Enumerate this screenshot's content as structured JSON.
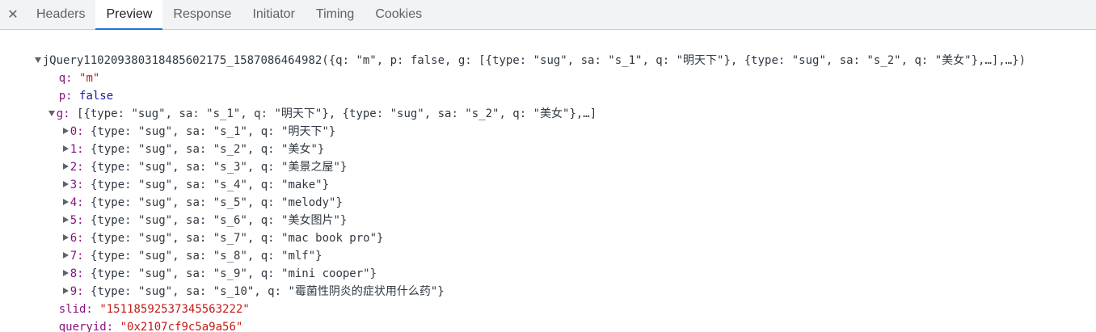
{
  "tabs": {
    "close": "✕",
    "items": [
      "Headers",
      "Preview",
      "Response",
      "Initiator",
      "Timing",
      "Cookies"
    ],
    "active": "Preview"
  },
  "preview": {
    "root_summary": "jQuery110209380318485602175_1587086464982({q: \"m\", p: false, g: [{type: \"sug\", sa: \"s_1\", q: \"明天下\"}, {type: \"sug\", sa: \"s_2\", q: \"美女\"},…],…})",
    "q": {
      "key": "q:",
      "value": "\"m\""
    },
    "p": {
      "key": "p:",
      "value": "false"
    },
    "g": {
      "key": "g:",
      "summary": "[{type: \"sug\", sa: \"s_1\", q: \"明天下\"}, {type: \"sug\", sa: \"s_2\", q: \"美女\"},…]",
      "items": [
        {
          "key": "0:",
          "value": "{type: \"sug\", sa: \"s_1\", q: \"明天下\"}"
        },
        {
          "key": "1:",
          "value": "{type: \"sug\", sa: \"s_2\", q: \"美女\"}"
        },
        {
          "key": "2:",
          "value": "{type: \"sug\", sa: \"s_3\", q: \"美景之屋\"}"
        },
        {
          "key": "3:",
          "value": "{type: \"sug\", sa: \"s_4\", q: \"make\"}"
        },
        {
          "key": "4:",
          "value": "{type: \"sug\", sa: \"s_5\", q: \"melody\"}"
        },
        {
          "key": "5:",
          "value": "{type: \"sug\", sa: \"s_6\", q: \"美女图片\"}"
        },
        {
          "key": "6:",
          "value": "{type: \"sug\", sa: \"s_7\", q: \"mac book pro\"}"
        },
        {
          "key": "7:",
          "value": "{type: \"sug\", sa: \"s_8\", q: \"mlf\"}"
        },
        {
          "key": "8:",
          "value": "{type: \"sug\", sa: \"s_9\", q: \"mini cooper\"}"
        },
        {
          "key": "9:",
          "value": "{type: \"sug\", sa: \"s_10\", q: \"霉菌性阴炎的症状用什么药\"}"
        }
      ]
    },
    "slid": {
      "key": "slid:",
      "value": "\"15118592537345563222\""
    },
    "queryid": {
      "key": "queryid:",
      "value": "\"0x2107cf9c5a9a56\""
    }
  },
  "colors": {
    "key": "#881280",
    "string": "#c41a16",
    "boolean": "#1a1aa6",
    "tab_accent": "#1a73e8"
  }
}
